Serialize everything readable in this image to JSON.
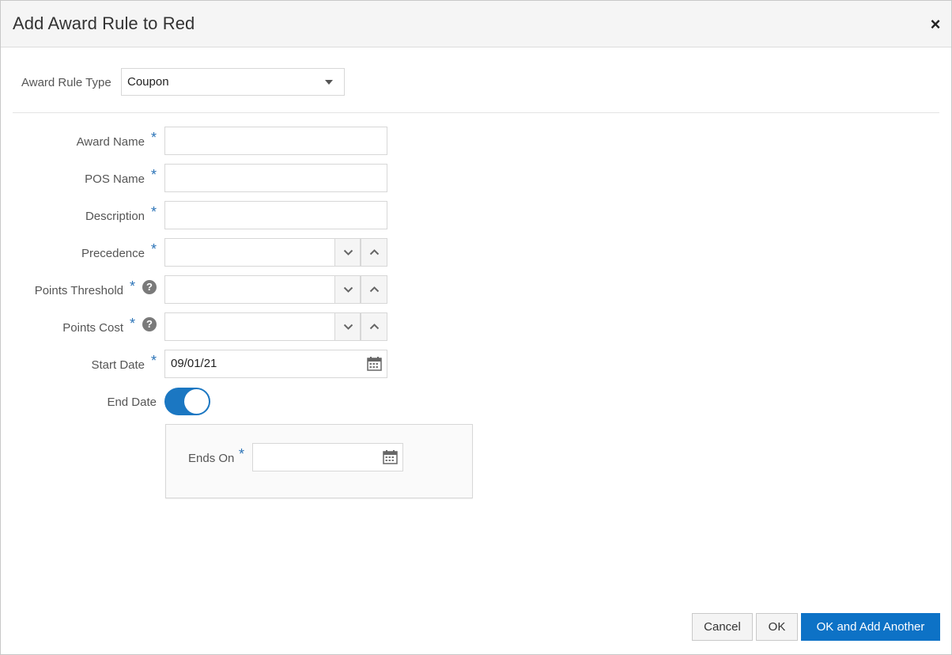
{
  "dialog": {
    "title": "Add Award Rule to Red",
    "close_symbol": "×"
  },
  "award_rule_type": {
    "label": "Award Rule Type",
    "selected": "Coupon"
  },
  "form": {
    "award_name": {
      "label": "Award Name",
      "value": ""
    },
    "pos_name": {
      "label": "POS Name",
      "value": ""
    },
    "description": {
      "label": "Description",
      "value": ""
    },
    "precedence": {
      "label": "Precedence",
      "value": ""
    },
    "points_threshold": {
      "label": "Points Threshold",
      "value": ""
    },
    "points_cost": {
      "label": "Points Cost",
      "value": ""
    },
    "start_date": {
      "label": "Start Date",
      "value": "09/01/21"
    },
    "end_date": {
      "label": "End Date",
      "enabled": true
    },
    "ends_on": {
      "label": "Ends On",
      "value": ""
    }
  },
  "required_mark": "*",
  "help_mark": "?",
  "buttons": {
    "cancel": "Cancel",
    "ok": "OK",
    "ok_add_another": "OK and Add Another"
  },
  "colors": {
    "accent": "#0d72c6",
    "toggle_on": "#1b77c2",
    "required": "#2b73b7"
  },
  "icons": {
    "close": "close-icon",
    "dropdown": "chevron-down-icon",
    "decrement": "chevron-down-icon",
    "increment": "chevron-up-icon",
    "calendar": "calendar-icon",
    "help": "help-icon"
  }
}
